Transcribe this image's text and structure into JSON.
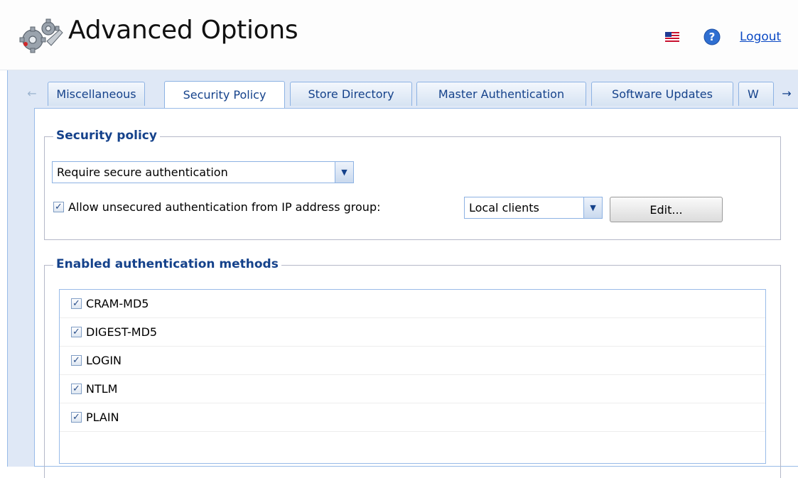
{
  "header": {
    "title": "Advanced Options",
    "logout_label": "Logout",
    "icons": [
      "gears-icon",
      "us-flag-icon",
      "help-icon"
    ]
  },
  "tabs": [
    {
      "label": "Miscellaneous",
      "active": false
    },
    {
      "label": "Security Policy",
      "active": true
    },
    {
      "label": "Store Directory",
      "active": false
    },
    {
      "label": "Master Authentication",
      "active": false
    },
    {
      "label": "Software Updates",
      "active": false
    },
    {
      "label": "W",
      "active": false
    }
  ],
  "security_policy": {
    "legend": "Security policy",
    "policy_select_value": "Require secure authentication",
    "allow_unsecured_checked": true,
    "allow_unsecured_label": "Allow unsecured authentication from IP address group:",
    "ip_group_select_value": "Local clients",
    "edit_button_label": "Edit..."
  },
  "auth_methods": {
    "legend": "Enabled authentication methods",
    "items": [
      {
        "label": "CRAM-MD5",
        "checked": true
      },
      {
        "label": "DIGEST-MD5",
        "checked": true
      },
      {
        "label": "LOGIN",
        "checked": true
      },
      {
        "label": "NTLM",
        "checked": true
      },
      {
        "label": "PLAIN",
        "checked": true
      }
    ]
  },
  "colors": {
    "accent": "#15428b",
    "panel_bg": "#dfe8f6",
    "border": "#99bbe8",
    "link": "#0b49c4"
  }
}
